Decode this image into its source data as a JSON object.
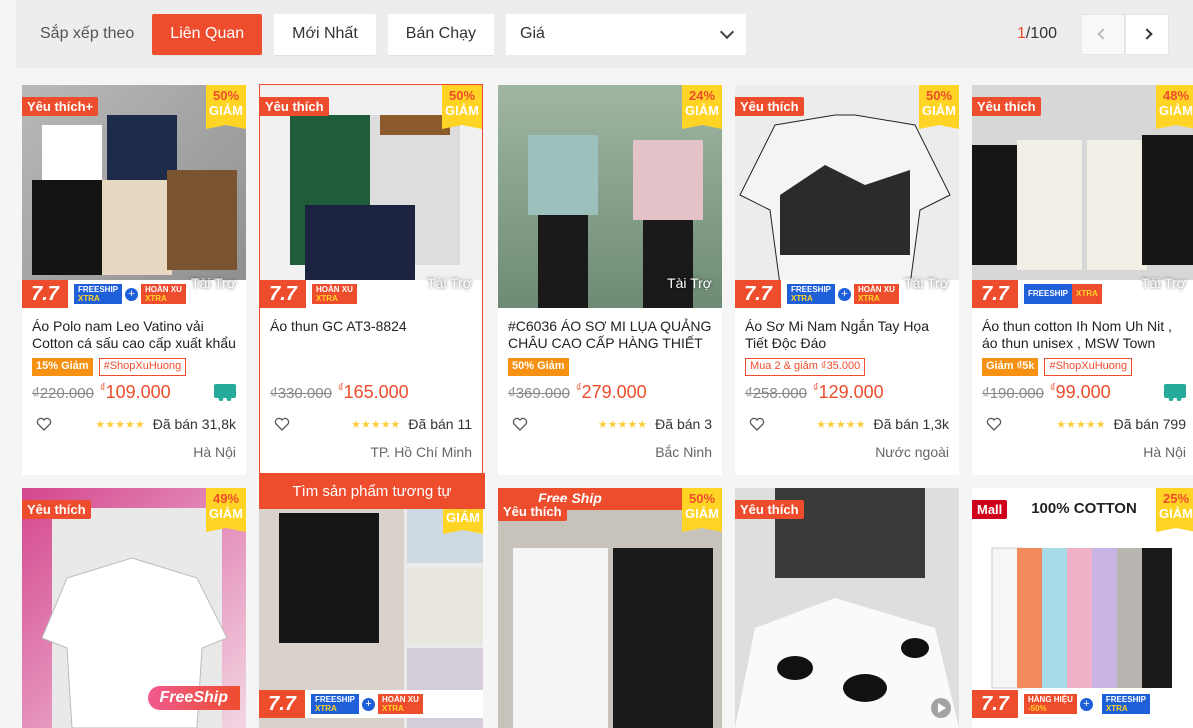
{
  "sortbar": {
    "label": "Sắp xếp theo",
    "options": [
      "Liên Quan",
      "Mới Nhất",
      "Bán Chạy"
    ],
    "active": "Liên Quan",
    "price_select": "Giá",
    "page_current": "1",
    "page_total": "/100"
  },
  "products": [
    {
      "name": "Áo Polo nam Leo Vatino vải Cotton cá sấu cao cấp xuất khẩu",
      "badge": "Yêu thích+",
      "discount_pct": "50%",
      "discount_word": "GIẢM",
      "sponsored": "Tài Trợ",
      "tags": [
        {
          "text": "15% Giảm",
          "style": "fill"
        },
        {
          "text": "#ShopXuHuong",
          "style": "line"
        }
      ],
      "old_price": "₫220.000",
      "price_sym": "₫",
      "price": "109.000",
      "sold": "Đã bán 31,8k",
      "location": "Hà Nội",
      "freeship_icon": true
    },
    {
      "name": "Áo thun GC AT3-8824",
      "badge": "Yêu thích",
      "discount_pct": "50%",
      "discount_word": "GIẢM",
      "sponsored": "Tài Trợ",
      "tags": [],
      "old_price": "₫330.000",
      "price_sym": "₫",
      "price": "165.000",
      "sold": "Đã bán 11",
      "location": "TP. Hồ Chí Minh",
      "similar": "Tìm sản phẩm tương tự"
    },
    {
      "name": "#C6036 ÁO SƠ MI LỤA QUẢNG CHÂU CAO CẤP HÀNG THIẾT KẾ",
      "badge": "",
      "discount_pct": "24%",
      "discount_word": "GIẢM",
      "sponsored": "Tài Trợ",
      "tags": [
        {
          "text": "50% Giảm",
          "style": "fill"
        }
      ],
      "old_price": "₫369.000",
      "price_sym": "₫",
      "price": "279.000",
      "sold": "Đã bán 3",
      "location": "Bắc Ninh"
    },
    {
      "name": "Áo Sơ Mi Nam Ngắn Tay Họa Tiết Độc Đáo",
      "badge": "Yêu thích",
      "discount_pct": "50%",
      "discount_word": "GIẢM",
      "sponsored": "Tài Trợ",
      "tags": [
        {
          "text": "Mua 2 & giảm ₫35.000",
          "style": "line"
        }
      ],
      "old_price": "₫258.000",
      "price_sym": "₫",
      "price": "129.000",
      "sold": "Đã bán 1,3k",
      "location": "Nước ngoài"
    },
    {
      "name": "Áo thun cotton Ih Nom Uh Nit , áo thun unisex , MSW Town",
      "badge": "Yêu thích",
      "discount_pct": "48%",
      "discount_word": "GIẢM",
      "sponsored": "Tài Trợ",
      "tags": [
        {
          "text": "Giảm ₫5k",
          "style": "fill"
        },
        {
          "text": "#ShopXuHuong",
          "style": "line"
        }
      ],
      "old_price": "₫190.000",
      "price_sym": "₫",
      "price": "99.000",
      "sold": "Đã bán 799",
      "location": "Hà Nội",
      "freeship_icon": true
    }
  ],
  "row2": [
    {
      "badge": "Yêu thích",
      "discount_pct": "49%",
      "discount_word": "GIẢM",
      "pill": "FreeShip"
    },
    {
      "badge": "",
      "discount_pct": "",
      "discount_word": "GIẢM"
    },
    {
      "badge": "Yêu thích",
      "discount_pct": "50%",
      "discount_word": "GIẢM",
      "top_banner": "Free Ship"
    },
    {
      "badge": "Yêu thích",
      "discount_pct": "",
      "discount_word": ""
    },
    {
      "badge": "Mall",
      "discount_pct": "25%",
      "discount_word": "GIẢM",
      "title": "100% COTTON"
    }
  ],
  "strip": {
    "label_77": "7.7",
    "freeship": "FREESHIP",
    "xtra": "XTRA",
    "hoan_xu": "HOÀN XU",
    "hang_hieu": "HÀNG HIỆU",
    "hang_hieu_off": "-50%"
  },
  "colors": {
    "accent": "#ee4d2d",
    "discount_bg": "#ffd424",
    "tag_fill": "#f69113"
  }
}
